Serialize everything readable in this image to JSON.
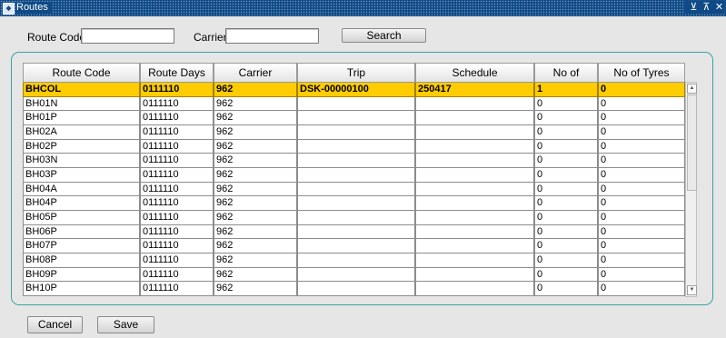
{
  "window": {
    "title": "Routes",
    "icon": "app-icon",
    "controls": [
      "⊻",
      "⊼",
      "✕"
    ]
  },
  "filters": {
    "route_code_label": "Route Code",
    "route_code_value": "",
    "carrier_label": "Carrier",
    "carrier_value": "",
    "search_label": "Search"
  },
  "table": {
    "columns": [
      "Route Code",
      "Route Days",
      "Carrier",
      "Trip",
      "Schedule",
      "No of Orders",
      "No of Tyres"
    ],
    "rows": [
      [
        "BHCOL",
        "0111110",
        "962",
        "DSK-00000100",
        "250417",
        "1",
        "0"
      ],
      [
        "BH01N",
        "0111110",
        "962",
        "",
        "",
        "0",
        "0"
      ],
      [
        "BH01P",
        "0111110",
        "962",
        "",
        "",
        "0",
        "0"
      ],
      [
        "BH02A",
        "0111110",
        "962",
        "",
        "",
        "0",
        "0"
      ],
      [
        "BH02P",
        "0111110",
        "962",
        "",
        "",
        "0",
        "0"
      ],
      [
        "BH03N",
        "0111110",
        "962",
        "",
        "",
        "0",
        "0"
      ],
      [
        "BH03P",
        "0111110",
        "962",
        "",
        "",
        "0",
        "0"
      ],
      [
        "BH04A",
        "0111110",
        "962",
        "",
        "",
        "0",
        "0"
      ],
      [
        "BH04P",
        "0111110",
        "962",
        "",
        "",
        "0",
        "0"
      ],
      [
        "BH05P",
        "0111110",
        "962",
        "",
        "",
        "0",
        "0"
      ],
      [
        "BH06P",
        "0111110",
        "962",
        "",
        "",
        "0",
        "0"
      ],
      [
        "BH07P",
        "0111110",
        "962",
        "",
        "",
        "0",
        "0"
      ],
      [
        "BH08P",
        "0111110",
        "962",
        "",
        "",
        "0",
        "0"
      ],
      [
        "BH09P",
        "0111110",
        "962",
        "",
        "",
        "0",
        "0"
      ],
      [
        "BH10P",
        "0111110",
        "962",
        "",
        "",
        "0",
        "0"
      ]
    ],
    "selected_row": 0,
    "selection_color": "#ffcc00"
  },
  "footer": {
    "cancel_label": "Cancel",
    "save_label": "Save"
  },
  "colors": {
    "titlebar": "#0f4a86",
    "panel_border": "#3aa3a3",
    "background": "#e6e6e6"
  }
}
